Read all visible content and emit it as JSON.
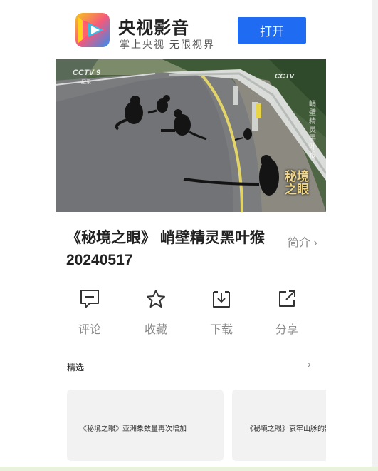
{
  "banner": {
    "app_name": "央视影音",
    "slogan": "掌上央视  无限视界",
    "open_button": "打开"
  },
  "video": {
    "watermark_left": "CCTV 9",
    "watermark_left_sub": "纪录",
    "watermark_right": "CCTV",
    "vertical_caption": "峭壁精灵黑叶猴",
    "program_logo": "秘境之眼"
  },
  "title": {
    "text": "《秘境之眼》 峭壁精灵黑叶猴 20240517",
    "intro_link": "简介 ›"
  },
  "actions": [
    {
      "label": "评论",
      "icon": "comment-icon"
    },
    {
      "label": "收藏",
      "icon": "star-icon"
    },
    {
      "label": "下载",
      "icon": "download-icon"
    },
    {
      "label": "分享",
      "icon": "share-icon"
    }
  ],
  "featured": {
    "title": "精选",
    "arrow": "›",
    "items": [
      {
        "title": "《秘境之眼》亚洲象数量再次增加"
      },
      {
        "title": "《秘境之眼》哀牢山脉的野"
      }
    ]
  },
  "colors": {
    "accent": "#1f6cf2",
    "muted_text": "#888888",
    "card_bg": "#f2f2f2"
  }
}
